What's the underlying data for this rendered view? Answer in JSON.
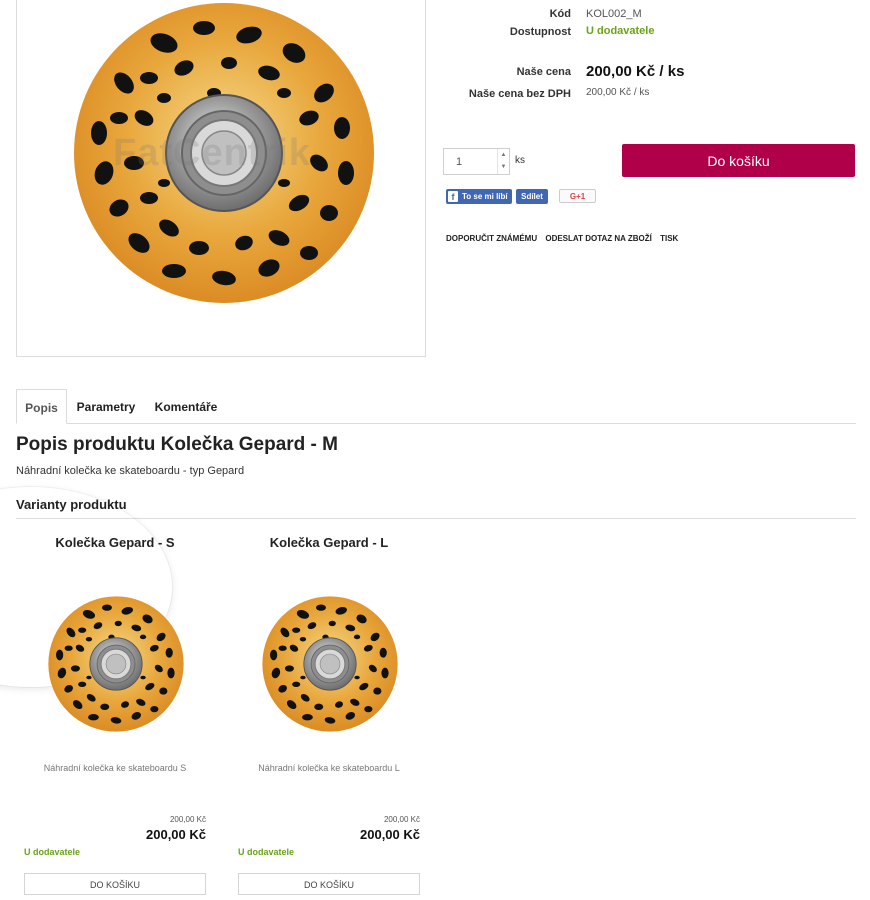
{
  "product": {
    "code_label": "Kód",
    "code_value": "KOL002_M",
    "availability_label": "Dostupnost",
    "availability_value": "U dodavatele",
    "price_label": "Naše cena",
    "price_value": "200,00 Kč / ks",
    "price_novat_label": "Naše cena bez DPH",
    "price_novat_value": "200,00 Kč / ks",
    "image_watermark": "FatCentrik"
  },
  "order": {
    "quantity_value": "1",
    "spin_up": "▲",
    "spin_down": "▼",
    "unit": "ks",
    "add_to_cart": "Do košíku"
  },
  "social": {
    "fb_like": "To se mi líbí",
    "fb_icon": "f",
    "fb_share": "Sdílet",
    "gplus": "G+1"
  },
  "actions": {
    "recommend": "DOPORUČIT ZNÁMÉMU",
    "ask": "ODESLAT DOTAZ NA ZBOŽÍ",
    "print": "TISK"
  },
  "tabs": [
    {
      "label": "Popis"
    },
    {
      "label": "Parametry"
    },
    {
      "label": "Komentáře"
    }
  ],
  "description": {
    "title": "Popis produktu Kolečka Gepard - M",
    "text": "Náhradní kolečka ke skateboardu - typ Gepard"
  },
  "variants": {
    "heading": "Varianty produktu",
    "items": [
      {
        "title": "Kolečka Gepard - S",
        "desc": "Náhradní kolečka ke skateboardu S",
        "price_small": "200,00 Kč",
        "price": "200,00 Kč",
        "stock": "U dodavatele",
        "button": "DO KOŠÍKU"
      },
      {
        "title": "Kolečka Gepard - L",
        "desc": "Náhradní kolečka ke skateboardu L",
        "price_small": "200,00 Kč",
        "price": "200,00 Kč",
        "stock": "U dodavatele",
        "button": "DO KOŠÍKU"
      }
    ]
  },
  "colors": {
    "accent": "#b0004a",
    "stock_green": "#6aa318",
    "facebook": "#4267b2"
  }
}
